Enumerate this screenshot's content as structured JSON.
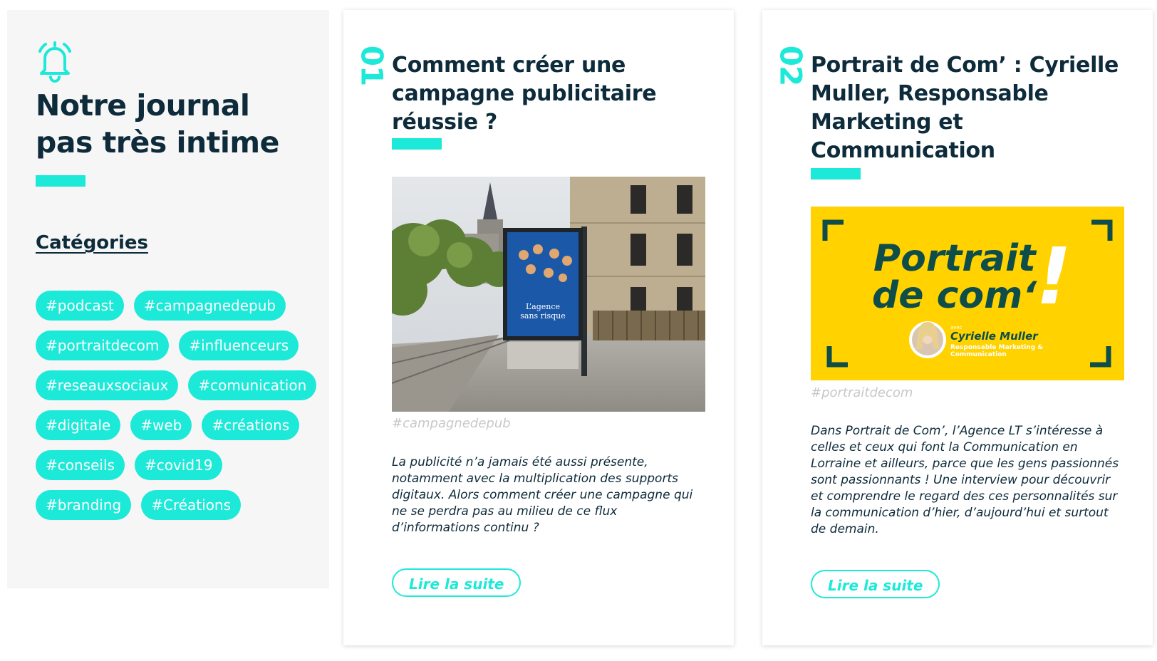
{
  "sidebar": {
    "title_line1": "Notre journal",
    "title_line2": "pas très intime",
    "categories_title": "Catégories",
    "tags": [
      "#podcast",
      "#campagnedepub",
      "#portraitdecom",
      "#influenceurs",
      "#reseauxsociaux",
      "#comunication",
      "#digitale",
      "#web",
      "#créations",
      "#conseils",
      "#covid19",
      "#branding",
      "#Créations"
    ]
  },
  "articles": [
    {
      "number": "01",
      "title": "Comment créer une campagne publicitaire réussie ?",
      "hashtag": "#campagnedepub",
      "excerpt": "La publicité n’a jamais été aussi présente, notamment avec la multiplication des supports digitaux. Alors comment créer une campagne qui ne se perdra pas au milieu de ce flux d’informations continu ?",
      "cta": "Lire la suite",
      "image": {
        "poster_line1": "L’agence",
        "poster_line2": "sans risque"
      }
    },
    {
      "number": "02",
      "title": "Portrait de Com’ : Cyrielle Muller, Responsable Marketing et Communication",
      "hashtag": "#portraitdecom",
      "excerpt": "Dans Portrait de Com’, l’Agence LT s’intéresse à celles et ceux qui font la Communication en Lorraine et ailleurs, parce que les gens passionnés sont passionnants ! Une interview pour découvrir et comprendre le regard des ces personnalités sur la communication d’hier, d’aujourd’hui et surtout de demain.",
      "cta": "Lire la suite",
      "image": {
        "headline_1": "Portrait",
        "headline_2": "de com‘",
        "exclamation": "!",
        "avec": "avec",
        "name": "Cyrielle Muller",
        "role_1": "Responsable Marketing &",
        "role_2": "Communication"
      }
    }
  ],
  "colors": {
    "accent": "#1de9d9",
    "navy": "#0d2b3a",
    "yellow": "#ffd200",
    "muted": "#c8c8c8"
  }
}
